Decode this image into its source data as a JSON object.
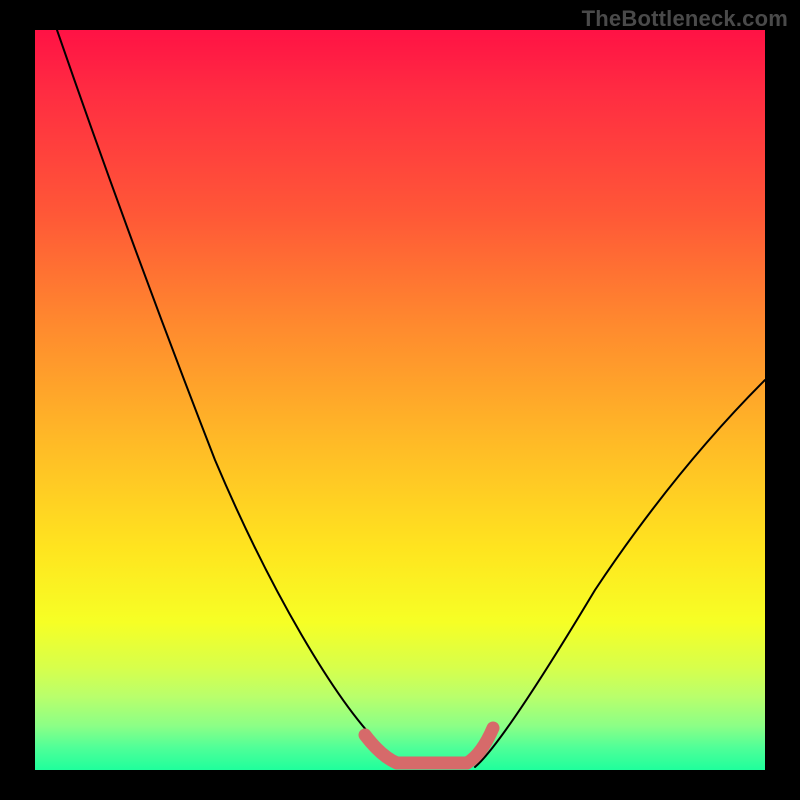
{
  "watermark": {
    "text": "TheBottleneck.com"
  },
  "chart_data": {
    "type": "line",
    "title": "",
    "xlabel": "",
    "ylabel": "",
    "xlim": [
      0,
      100
    ],
    "ylim": [
      0,
      100
    ],
    "grid": false,
    "legend": "none",
    "background_gradient": {
      "direction": "vertical",
      "stops": [
        {
          "pos": 0,
          "color": "#ff1245"
        },
        {
          "pos": 25,
          "color": "#ff5837"
        },
        {
          "pos": 55,
          "color": "#ffb827"
        },
        {
          "pos": 80,
          "color": "#f6ff25"
        },
        {
          "pos": 94,
          "color": "#8cff86"
        },
        {
          "pos": 100,
          "color": "#1fff9c"
        }
      ]
    },
    "series": [
      {
        "name": "left-curve",
        "color": "#000000",
        "x": [
          3,
          10,
          20,
          30,
          38,
          44,
          48,
          50
        ],
        "y": [
          100,
          81,
          56,
          34,
          18,
          8,
          3,
          2
        ]
      },
      {
        "name": "right-curve",
        "color": "#000000",
        "x": [
          58,
          62,
          68,
          76,
          84,
          92,
          100
        ],
        "y": [
          2,
          5,
          12,
          24,
          37,
          48,
          55
        ]
      },
      {
        "name": "valley-marker",
        "color": "#d66a6a",
        "x": [
          45,
          48,
          50,
          53,
          56,
          58,
          60
        ],
        "y": [
          4,
          2,
          2,
          2,
          2,
          3,
          6
        ]
      }
    ],
    "annotations": []
  }
}
